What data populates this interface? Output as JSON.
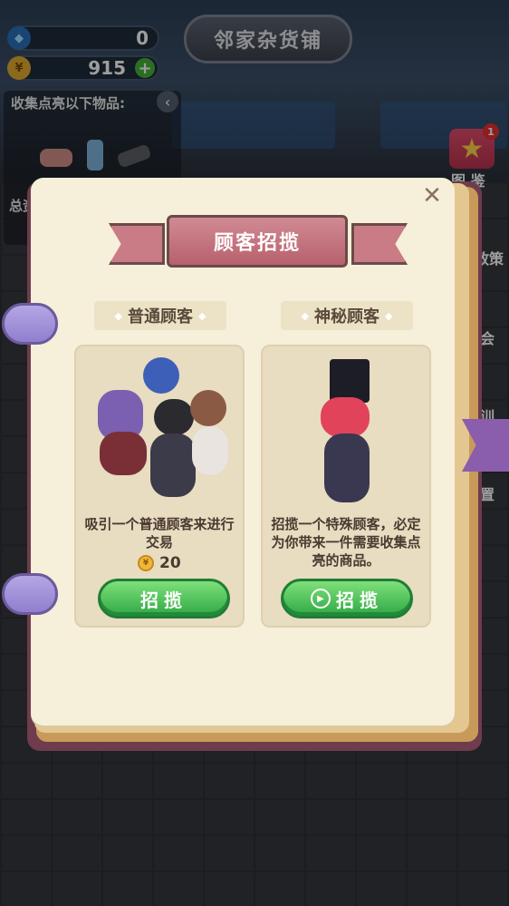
{
  "currency": {
    "gems": "0",
    "coins": "915",
    "gem_icon": "diamond-icon",
    "coin_icon": "yen-coin-icon",
    "plus_icon": "plus-icon"
  },
  "shop_name": "邻家杂货铺",
  "collect_panel": {
    "title": "收集点亮以下物品:",
    "total_label": "总资"
  },
  "side_menu": {
    "codex_label": "图 鉴",
    "codex_badge": "1",
    "policy_label": "政策",
    "meeting_label": "会",
    "other1": "训",
    "other2": "置"
  },
  "dialog": {
    "title": "顾客招揽",
    "close_icon": "close-icon"
  },
  "cards": [
    {
      "tag": "普通顾客",
      "description": "吸引一个普通顾客来进行交易",
      "price": "20",
      "button_label": "招揽"
    },
    {
      "tag": "神秘顾客",
      "description": "招揽一个特殊顾客，必定为你带来一件需要收集点亮的商品。",
      "button_label": "招揽",
      "button_icon": "play-video-icon"
    }
  ],
  "colors": {
    "book_page": "#f6efd9",
    "ribbon": "#c97c86",
    "button_green": "#2ea844",
    "card_bg": "#e8dcc1"
  }
}
